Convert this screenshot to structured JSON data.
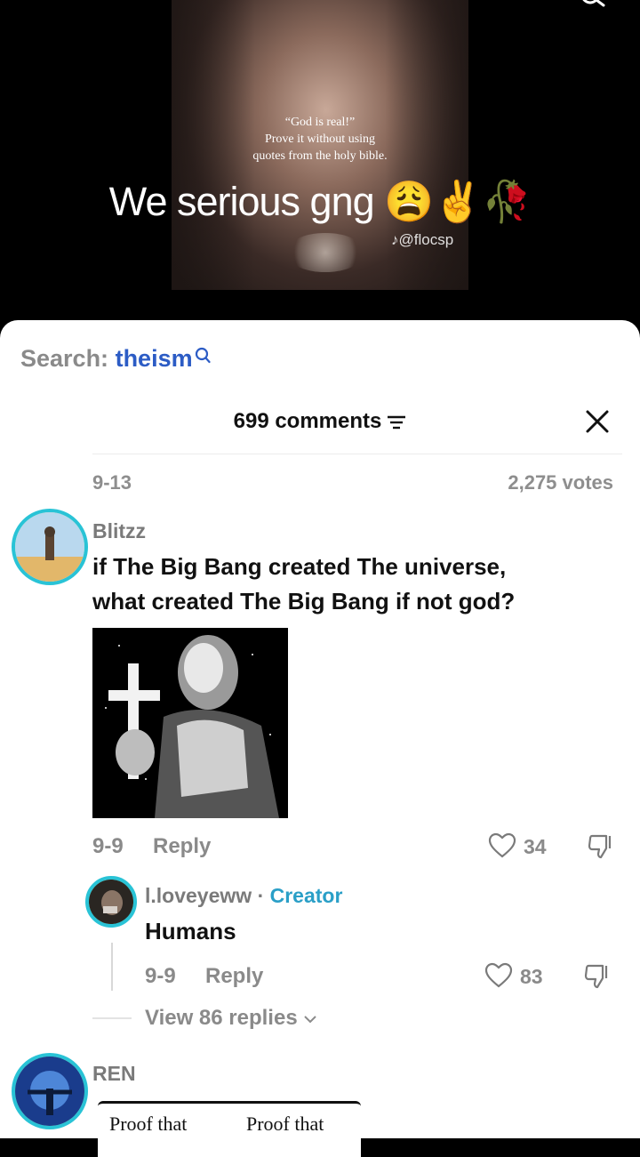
{
  "video": {
    "quote_line1": "“God is real!”",
    "quote_line2": "Prove it without using",
    "quote_line3": "quotes from the holy bible.",
    "caption": "We serious gng 😩✌️🥀",
    "watermark": "♪@flocsp"
  },
  "search": {
    "prefix": "Search:",
    "term": "theism",
    "icon": "search-icon"
  },
  "header": {
    "comment_count": "699 comments",
    "sort_icon": "sort-icon",
    "close_icon": "close-icon"
  },
  "summary": {
    "date": "9-13",
    "votes": "2,275 votes"
  },
  "comments": [
    {
      "username": "Blitzz",
      "text_line1": "if The Big Bang created The universe,",
      "text_line2": "what created The Big Bang if not god?",
      "date": "9-9",
      "reply_label": "Reply",
      "likes": "34"
    },
    {
      "username": "l.loveyeww",
      "separator": "·",
      "badge": "Creator",
      "text": "Humans",
      "date": "9-9",
      "reply_label": "Reply",
      "likes": "83"
    },
    {
      "username": "REN",
      "image_text_left": "Proof that",
      "image_text_right": "Proof that"
    }
  ],
  "view_replies": "View 86 replies",
  "colors": {
    "accent_blue": "#2c5cc5",
    "creator_teal": "#2a9fc7",
    "avatar_ring": "#29c3d6"
  }
}
